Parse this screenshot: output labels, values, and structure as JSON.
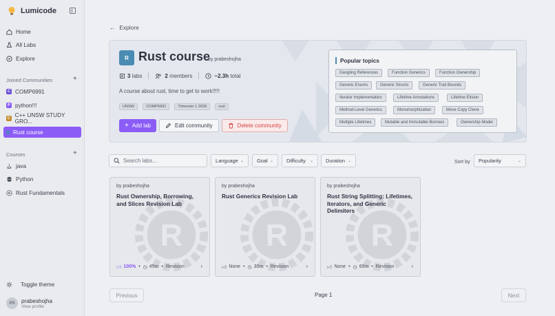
{
  "app": {
    "name": "Lumicode"
  },
  "sidebar": {
    "nav": [
      {
        "label": "Home",
        "icon": "home-icon"
      },
      {
        "label": "All Labs",
        "icon": "labs-icon"
      },
      {
        "label": "Explore",
        "icon": "compass-icon"
      }
    ],
    "communities_heading": "Joined Communities",
    "communities": [
      {
        "label": "COMP6991",
        "badge": "C",
        "color": "#6d4fd8"
      },
      {
        "label": "python!!!",
        "badge": "P",
        "color": "#8b5cf6"
      },
      {
        "label": "C++ UNSW STUDY GRO...",
        "badge": "C",
        "color": "#c58a2a"
      },
      {
        "label": "Rust course",
        "badge": "R",
        "color": "#4a8bb3",
        "active": true
      }
    ],
    "courses_heading": "Courses",
    "courses": [
      {
        "label": "java",
        "icon": "java-icon"
      },
      {
        "label": "Python",
        "icon": "python-icon"
      },
      {
        "label": "Rust Fundamentals",
        "icon": "rust-icon"
      }
    ],
    "toggle_theme": "Toggle theme",
    "user": {
      "initials": "PR",
      "name": "prabeshojha",
      "sub": "View profile"
    }
  },
  "main": {
    "back_label": "Explore",
    "course": {
      "badge": "R",
      "title": "Rust course",
      "by": "by prabeshojha",
      "labs_count": "3",
      "labs_label": "labs",
      "members_count": "2",
      "members_label": "members",
      "total_time": "~2.3h",
      "total_label": "total",
      "description": "A course about rust, time to get to work!!!!!",
      "tags": [
        "UNSW",
        "COMP6991",
        "Trimester 1 2026",
        "rust"
      ],
      "add_lab": "Add lab",
      "edit": "Edit community",
      "delete": "Delete community"
    },
    "topics": {
      "heading": "Popular topics",
      "items": [
        "Dangling References",
        "Function Generics",
        "Function Ownership",
        "Generic Enums",
        "Generic Structs",
        "Generic Trait Bounds",
        "Iterator Implementation",
        "Lifetime Annotations",
        "Lifetime Elision",
        "Method-Level Generics",
        "Monomorphization",
        "Move Copy Clone",
        "Multiple Lifetimes",
        "Mutable and Immutable Borrows",
        "Ownership Model"
      ]
    },
    "filters": {
      "search_placeholder": "Search labs...",
      "language": "Language",
      "goal": "Goal",
      "difficulty": "Difficulty",
      "duration": "Duration",
      "sort_label": "Sort by",
      "sort_value": "Popularity"
    },
    "labs": [
      {
        "by": "by prabeshojha",
        "title": "Rust Ownership, Borrowing, and Slices Revision Lab",
        "likes": "100%",
        "time": "45m",
        "type": "Revision"
      },
      {
        "by": "by prabeshojha",
        "title": "Rust Generics Revision Lab",
        "likes": "None",
        "time": "30m",
        "type": "Revision"
      },
      {
        "by": "by prabeshojha",
        "title": "Rust String Splitting: Lifetimes, Iterators, and Generic Delimiters",
        "likes": "None",
        "time": "60m",
        "type": "Revision"
      }
    ],
    "pagination": {
      "prev": "Previous",
      "page": "Page 1",
      "next": "Next"
    }
  }
}
